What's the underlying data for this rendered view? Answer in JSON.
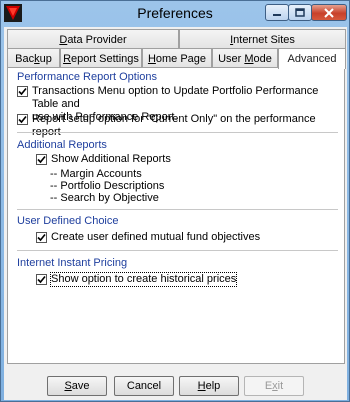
{
  "window": {
    "title": "Preferences"
  },
  "titlebar": {
    "minimize": "minimize",
    "maximize": "maximize",
    "close": "close"
  },
  "tabs_top": [
    {
      "label": "Data Provider",
      "mnemonic": "D"
    },
    {
      "label": "Internet Sites",
      "mnemonic": "I"
    }
  ],
  "tabs_bottom": [
    {
      "label_pre": "Bac",
      "mnemonic": "k",
      "label_post": "up"
    },
    {
      "label_pre": "",
      "mnemonic": "R",
      "label_post": "eport Settings"
    },
    {
      "label_pre": "",
      "mnemonic": "H",
      "label_post": "ome Page"
    },
    {
      "label_pre": "User ",
      "mnemonic": "M",
      "label_post": "ode"
    },
    {
      "label_pre": "Advanced",
      "mnemonic": "",
      "label_post": "",
      "active": true
    }
  ],
  "groups": {
    "performance": {
      "title": "Performance Report Options",
      "options": [
        {
          "line1": "Transactions Menu option to Update Portfolio Performance Table and",
          "line2": "use with Performance Report.",
          "checked": true
        },
        {
          "line1": "Report setup option for \"Current Only\" on the performance report",
          "checked": true
        }
      ]
    },
    "additional": {
      "title": "Additional Reports",
      "option": {
        "label": "Show Additional Reports",
        "checked": true
      },
      "items": [
        "-- Margin Accounts",
        "-- Portfolio Descriptions",
        "-- Search by Objective"
      ]
    },
    "user_defined": {
      "title": "User Defined Choice",
      "option": {
        "label": "Create user defined mutual fund objectives",
        "checked": true
      }
    },
    "internet": {
      "title": "Internet Instant Pricing",
      "option": {
        "label": "Show option to create historical prices",
        "checked": true
      }
    }
  },
  "buttons": {
    "save": "Save",
    "cancel": "Cancel",
    "help": "Help",
    "exit": "Exit"
  },
  "colors": {
    "group_title": "#1f3f9e",
    "close_button": "#c8412b",
    "app_icon": "#cc0000"
  }
}
